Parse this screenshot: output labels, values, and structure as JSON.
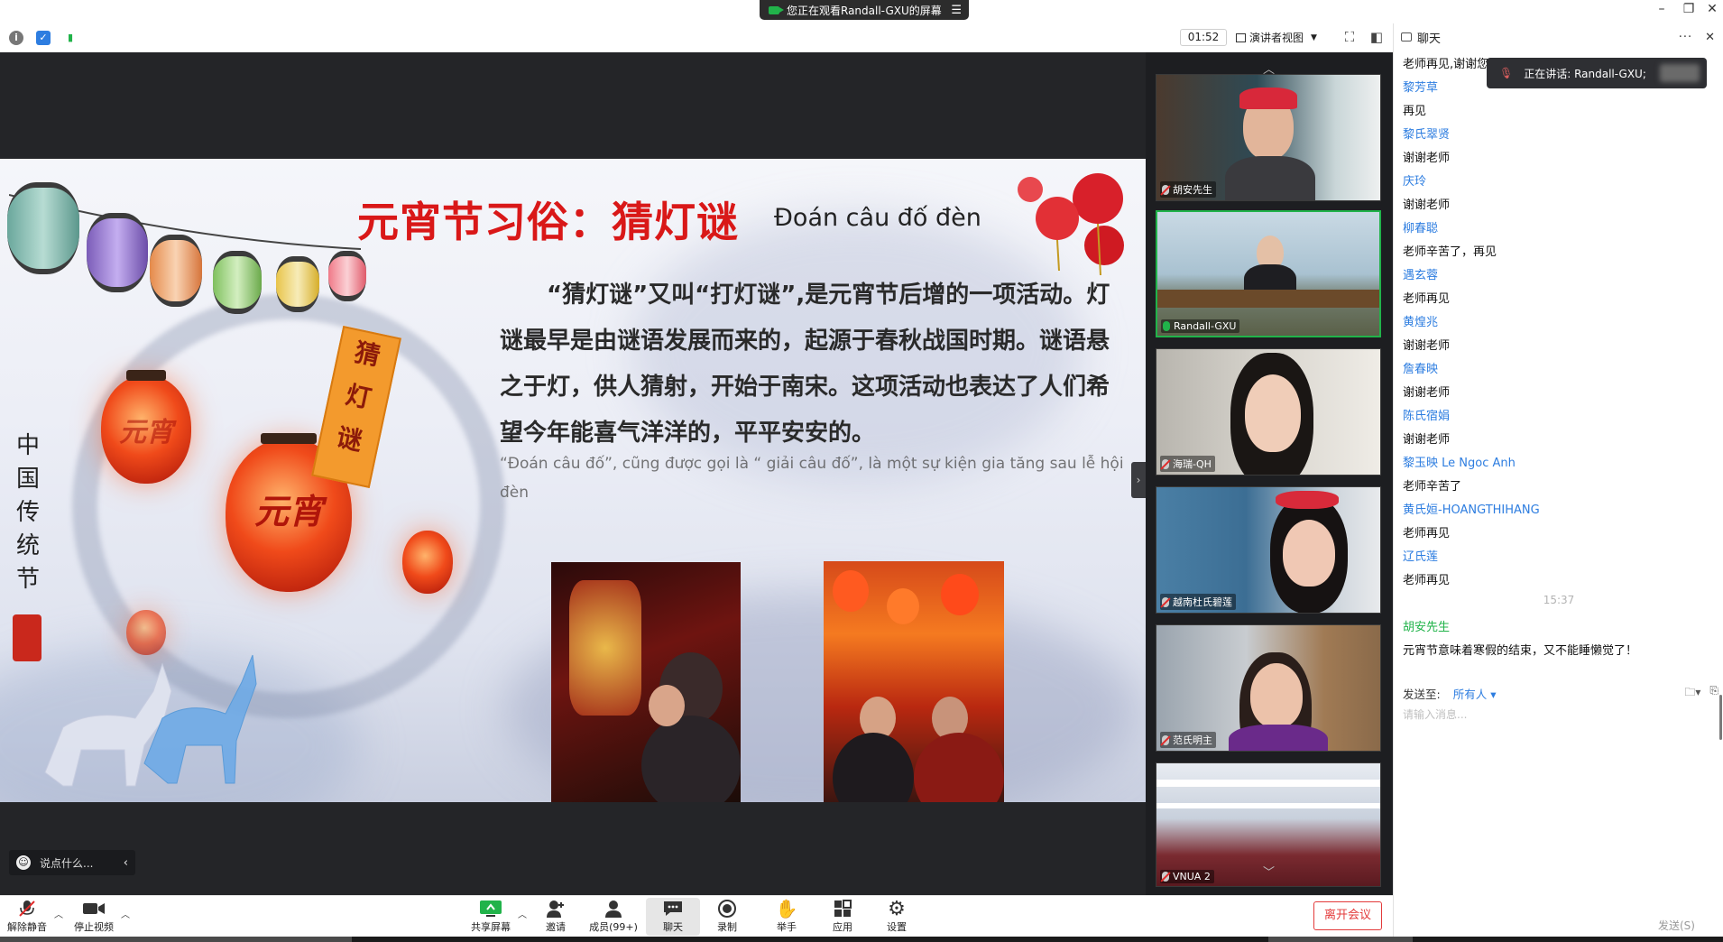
{
  "share_banner": {
    "text": "您正在观看Randall-GXU的屏幕"
  },
  "meeting_bar": {
    "timer": "01:52",
    "view_mode": "演讲者视图"
  },
  "slide": {
    "title": "元宵节习俗：猜灯谜",
    "subtitle": "Đoán câu đố đèn",
    "vertical_title": [
      "中",
      "国",
      "传",
      "统",
      "节"
    ],
    "tag_chars": [
      "猜",
      "灯",
      "谜"
    ],
    "lantern_text_1": "元宵",
    "lantern_text_2": "元宵",
    "body_zh": "“猜灯谜”又叫“打灯谜”,是元宵节后增的一项活动。灯谜最早是由谜语发展而来的，起源于春秋战国时期。谜语悬之于灯，供人猜射，开始于南宋。这项活动也表达了人们希望今年能喜气洋洋的，平平安安的。",
    "body_vi": "“Đoán câu đố”, cũng được gọi là “ giải câu đố”, là một sự kiện gia tăng sau lễ hội đèn"
  },
  "reaction": {
    "placeholder": "说点什么..."
  },
  "gallery": [
    {
      "name": "胡安先生",
      "mic": "muted",
      "active": false
    },
    {
      "name": "Randall-GXU",
      "mic": "on",
      "active": true
    },
    {
      "name": "海瑞-QH",
      "mic": "muted",
      "active": false
    },
    {
      "name": "越南杜氏碧莲",
      "mic": "muted",
      "active": false
    },
    {
      "name": "范氏明主",
      "mic": "muted",
      "active": false
    },
    {
      "name": "VNUA 2",
      "mic": "muted",
      "active": false
    }
  ],
  "chat": {
    "title": "聊天",
    "speaking": "正在讲话: Randall-GXU;",
    "messages": [
      {
        "type": "text",
        "text": "老师再见,谢谢您"
      },
      {
        "type": "sender",
        "text": "黎芳草"
      },
      {
        "type": "text",
        "text": "再见"
      },
      {
        "type": "sender",
        "text": "黎氏翠贤"
      },
      {
        "type": "text",
        "text": "谢谢老师"
      },
      {
        "type": "sender",
        "text": "庆玲"
      },
      {
        "type": "text",
        "text": "谢谢老师"
      },
      {
        "type": "sender",
        "text": "柳春聪"
      },
      {
        "type": "text",
        "text": "老师辛苦了，再见"
      },
      {
        "type": "sender",
        "text": "遇玄蓉"
      },
      {
        "type": "text",
        "text": "老师再见"
      },
      {
        "type": "sender",
        "text": "黄煌兆"
      },
      {
        "type": "text",
        "text": "谢谢老师"
      },
      {
        "type": "sender",
        "text": "詹春映"
      },
      {
        "type": "text",
        "text": "谢谢老师"
      },
      {
        "type": "sender",
        "text": "陈氏宿娟"
      },
      {
        "type": "text",
        "text": "谢谢老师"
      },
      {
        "type": "sender",
        "text": "黎玉映 Le Ngoc Anh"
      },
      {
        "type": "text",
        "text": "老师辛苦了"
      },
      {
        "type": "sender",
        "text": "黄氏姮-HOANGTHIHANG"
      },
      {
        "type": "text",
        "text": "老师再见"
      },
      {
        "type": "sender",
        "text": "辽氏莲"
      },
      {
        "type": "text",
        "text": "老师再见"
      },
      {
        "type": "time",
        "text": "15:37"
      },
      {
        "type": "sender-green",
        "text": "胡安先生"
      },
      {
        "type": "text",
        "text": "元宵节意味着寒假的结束，又不能睡懒觉了！"
      }
    ],
    "send_to_label": "发送至:",
    "send_to_value": "所有人",
    "input_placeholder": "请输入消息...",
    "send_button": "发送(S)"
  },
  "toolbar": {
    "unmute": "解除静音",
    "stop_video": "停止视频",
    "share_screen": "共享屏幕",
    "invite": "邀请",
    "members": "成员(99+)",
    "chat": "聊天",
    "record": "录制",
    "raise_hand": "举手",
    "apps": "应用",
    "settings": "设置",
    "leave": "离开会议"
  },
  "colors": {
    "accent_blue": "#2d7de0",
    "active_green": "#21b34a",
    "leave_red": "#e33a3a",
    "title_red": "#d91818"
  }
}
